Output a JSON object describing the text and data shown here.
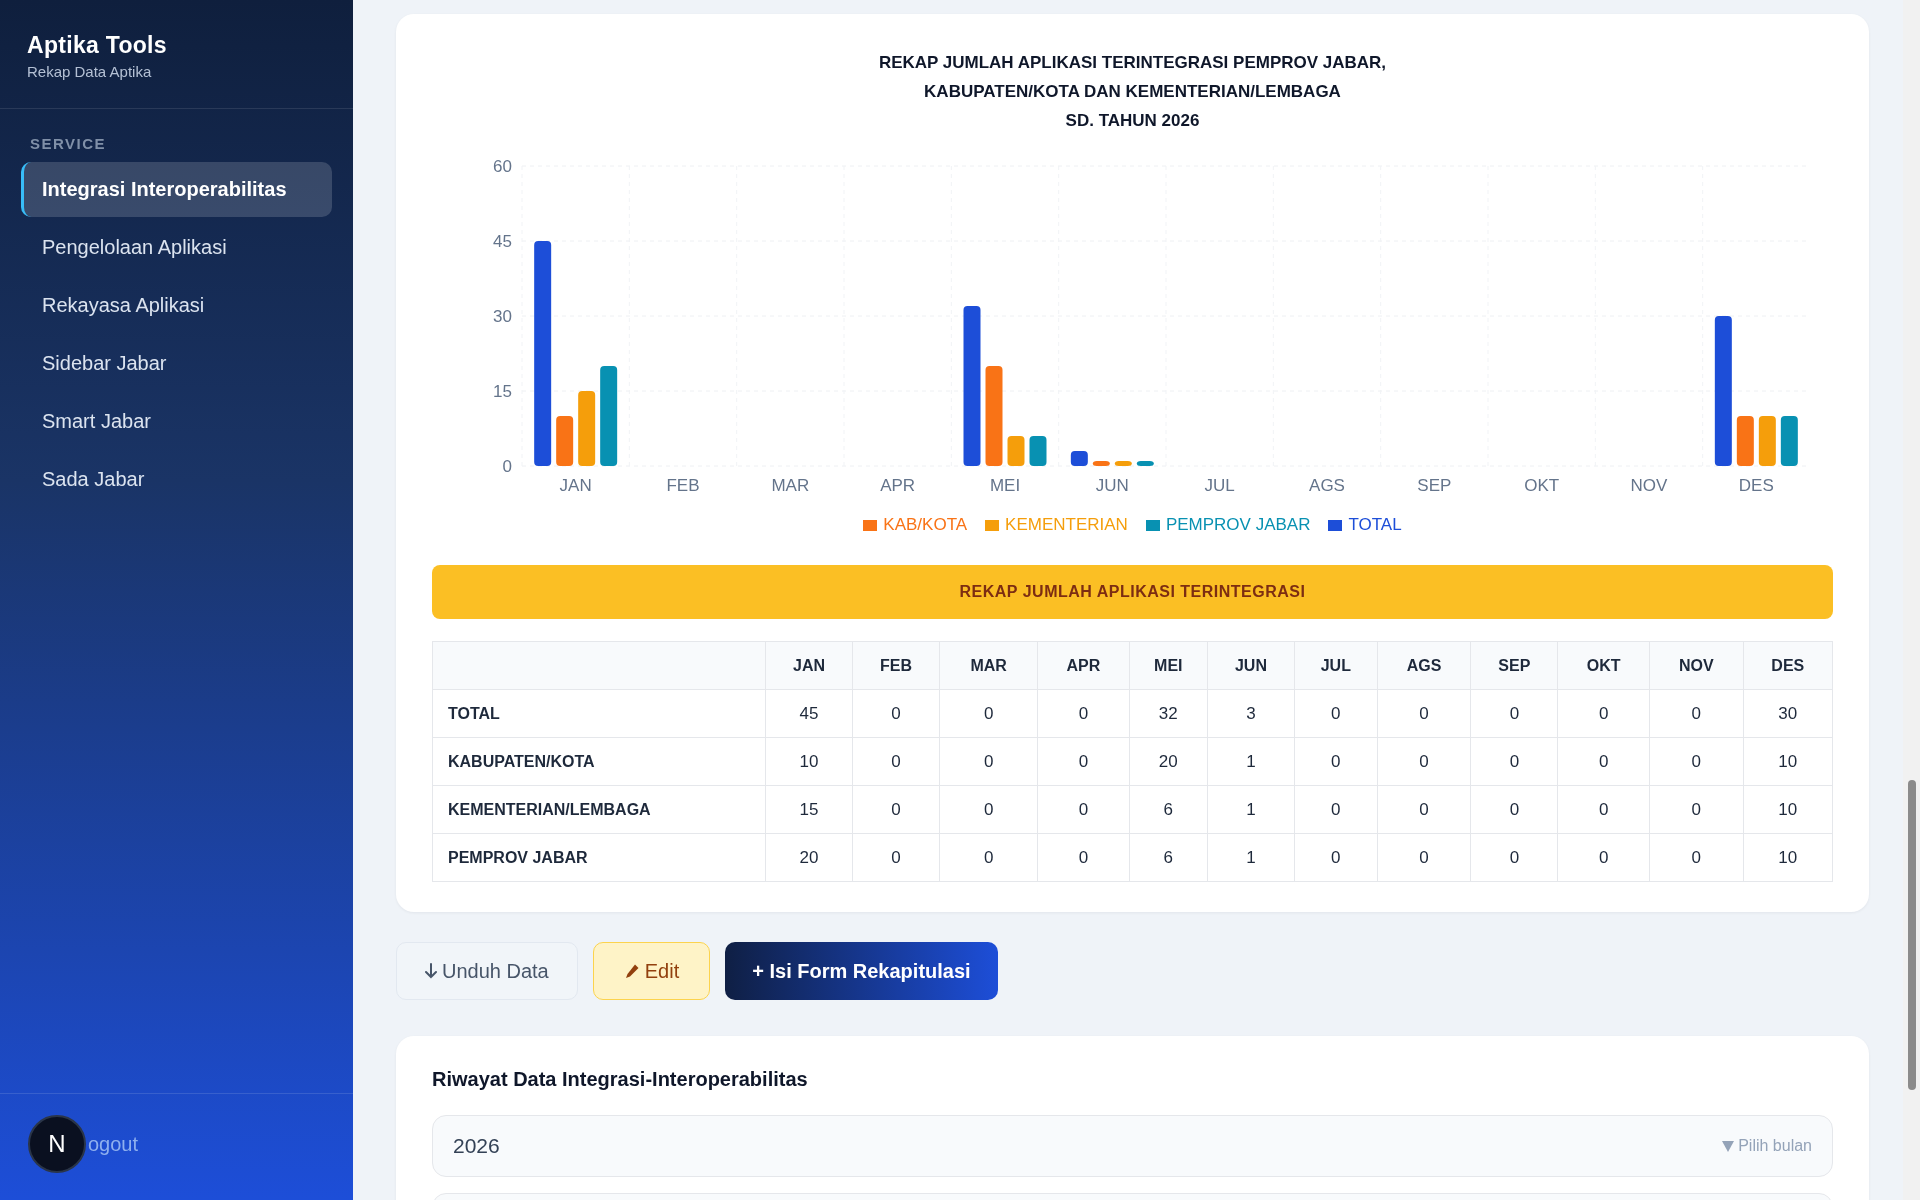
{
  "sidebar": {
    "app_title": "Aptika Tools",
    "app_subtitle": "Rekap Data Aptika",
    "section_label": "SERVICE",
    "items": [
      {
        "label": "Integrasi Interoperabilitas",
        "selected": true
      },
      {
        "label": "Pengelolaan Aplikasi",
        "selected": false
      },
      {
        "label": "Rekayasa Aplikasi",
        "selected": false
      },
      {
        "label": "Sidebar Jabar",
        "selected": false
      },
      {
        "label": "Smart Jabar",
        "selected": false
      },
      {
        "label": "Sada Jabar",
        "selected": false
      }
    ],
    "logout_label": "ogout",
    "dev_badge": "N"
  },
  "chart_card": {
    "title_lines": [
      "REKAP JUMLAH APLIKASI TERINTEGRASI PEMPROV JABAR,",
      "KABUPATEN/KOTA DAN KEMENTERIAN/LEMBAGA",
      "SD. TAHUN 2026"
    ],
    "chart_data": {
      "type": "bar",
      "grid": true,
      "categories": [
        "JAN",
        "FEB",
        "MAR",
        "APR",
        "MEI",
        "JUN",
        "JUL",
        "AGS",
        "SEP",
        "OKT",
        "NOV",
        "DES"
      ],
      "ylim": [
        0,
        60
      ],
      "yticks": [
        0,
        15,
        30,
        45,
        60
      ],
      "series": [
        {
          "name": "KAB/KOTA",
          "color": "#f97316",
          "values": [
            10,
            0,
            0,
            0,
            20,
            1,
            0,
            0,
            0,
            0,
            0,
            10
          ]
        },
        {
          "name": "KEMENTERIAN",
          "color": "#f59e0b",
          "values": [
            15,
            0,
            0,
            0,
            6,
            1,
            0,
            0,
            0,
            0,
            0,
            10
          ]
        },
        {
          "name": "PEMPROV JABAR",
          "color": "#0891b2",
          "values": [
            20,
            0,
            0,
            0,
            6,
            1,
            0,
            0,
            0,
            0,
            0,
            10
          ]
        },
        {
          "name": "TOTAL",
          "color": "#1d4ed8",
          "values": [
            45,
            0,
            0,
            0,
            32,
            3,
            0,
            0,
            0,
            0,
            0,
            30
          ]
        }
      ]
    },
    "table_banner": "REKAP JUMLAH APLIKASI TERINTEGRASI",
    "table": {
      "columns": [
        "",
        "JAN",
        "FEB",
        "MAR",
        "APR",
        "MEI",
        "JUN",
        "JUL",
        "AGS",
        "SEP",
        "OKT",
        "NOV",
        "DES"
      ],
      "rows": [
        [
          "TOTAL",
          "45",
          "0",
          "0",
          "0",
          "32",
          "3",
          "0",
          "0",
          "0",
          "0",
          "0",
          "30"
        ],
        [
          "KABUPATEN/KOTA",
          "10",
          "0",
          "0",
          "0",
          "20",
          "1",
          "0",
          "0",
          "0",
          "0",
          "0",
          "10"
        ],
        [
          "KEMENTERIAN/LEMBAGA",
          "15",
          "0",
          "0",
          "0",
          "6",
          "1",
          "0",
          "0",
          "0",
          "0",
          "0",
          "10"
        ],
        [
          "PEMPROV JABAR",
          "20",
          "0",
          "0",
          "0",
          "6",
          "1",
          "0",
          "0",
          "0",
          "0",
          "0",
          "10"
        ]
      ]
    }
  },
  "actions": [
    {
      "kind": "download",
      "label": "Unduh Data"
    },
    {
      "kind": "edit",
      "label": "Edit"
    },
    {
      "kind": "primary",
      "label": "+ Isi Form Rekapitulasi"
    }
  ],
  "history": {
    "title": "Riwayat Data Integrasi-Interoperabilitas",
    "year": "2026",
    "month_placeholder": "Pilih bulan"
  }
}
